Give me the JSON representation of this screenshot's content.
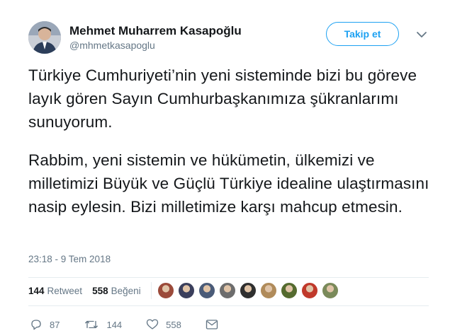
{
  "author": {
    "name": "Mehmet Muharrem Kasapoğlu",
    "handle": "@mhmetkasapoglu",
    "follow_label": "Takip et"
  },
  "tweet": {
    "paragraph1": "Türkiye Cumhuriyeti’nin yeni sisteminde bizi bu göreve layık gören Sayın Cumhurbaşkanımıza şükranlarımı sunuyorum.",
    "paragraph2": "Rabbim, yeni sistemin ve hükümetin, ülkemizi ve milletimizi Büyük ve Güçlü Türkiye idealine ulaştırmasını nasip eylesin. Bizi milletimize karşı mahcup etmesin.",
    "timestamp": "23:18 - 9 Tem 2018"
  },
  "stats": {
    "retweet_count": "144",
    "retweet_label": "Retweet",
    "like_count": "558",
    "like_label": "Beğeni",
    "likers": [
      {
        "name": "liker-1",
        "color": "#9b4a3a"
      },
      {
        "name": "liker-2",
        "color": "#3b3f5c"
      },
      {
        "name": "liker-3",
        "color": "#4a5b78"
      },
      {
        "name": "liker-4",
        "color": "#6d6d6d"
      },
      {
        "name": "liker-5",
        "color": "#2f2f2f"
      },
      {
        "name": "liker-6",
        "color": "#b08b5a"
      },
      {
        "name": "liker-7",
        "color": "#556b2f"
      },
      {
        "name": "liker-8",
        "color": "#c0392b"
      },
      {
        "name": "liker-9",
        "color": "#7a8a5a"
      }
    ]
  },
  "actions": {
    "reply_count": "87",
    "retweet_count": "144",
    "like_count": "558"
  },
  "colors": {
    "accent": "#1da1f2",
    "text": "#14171a",
    "muted": "#657786",
    "border": "#e6ecf0"
  }
}
